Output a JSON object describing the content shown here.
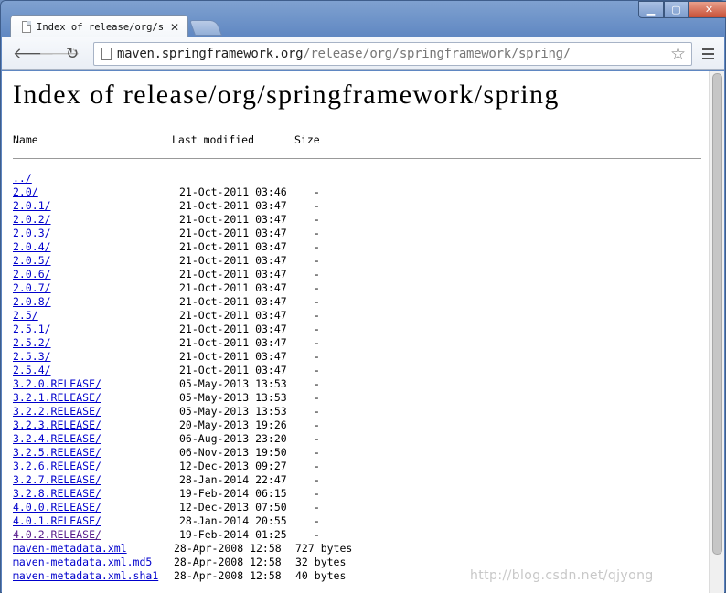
{
  "tab": {
    "title": "Index of release/org/sp"
  },
  "address_bar": {
    "host": "maven.springframework.org",
    "path": "/release/org/springframework/spring/"
  },
  "page": {
    "heading": "Index of release/org/springframework/spring",
    "columns": {
      "name": "Name",
      "modified": "Last modified",
      "size": "Size"
    },
    "dirs": [
      {
        "name": "../",
        "date": "",
        "size": ""
      },
      {
        "name": "2.0/",
        "date": "21-Oct-2011 03:46",
        "size": "-"
      },
      {
        "name": "2.0.1/",
        "date": "21-Oct-2011 03:47",
        "size": "-"
      },
      {
        "name": "2.0.2/",
        "date": "21-Oct-2011 03:47",
        "size": "-"
      },
      {
        "name": "2.0.3/",
        "date": "21-Oct-2011 03:47",
        "size": "-"
      },
      {
        "name": "2.0.4/",
        "date": "21-Oct-2011 03:47",
        "size": "-"
      },
      {
        "name": "2.0.5/",
        "date": "21-Oct-2011 03:47",
        "size": "-"
      },
      {
        "name": "2.0.6/",
        "date": "21-Oct-2011 03:47",
        "size": "-"
      },
      {
        "name": "2.0.7/",
        "date": "21-Oct-2011 03:47",
        "size": "-"
      },
      {
        "name": "2.0.8/",
        "date": "21-Oct-2011 03:47",
        "size": "-"
      },
      {
        "name": "2.5/",
        "date": "21-Oct-2011 03:47",
        "size": "-"
      },
      {
        "name": "2.5.1/",
        "date": "21-Oct-2011 03:47",
        "size": "-"
      },
      {
        "name": "2.5.2/",
        "date": "21-Oct-2011 03:47",
        "size": "-"
      },
      {
        "name": "2.5.3/",
        "date": "21-Oct-2011 03:47",
        "size": "-"
      },
      {
        "name": "2.5.4/",
        "date": "21-Oct-2011 03:47",
        "size": "-"
      },
      {
        "name": "3.2.0.RELEASE/",
        "date": "05-May-2013 13:53",
        "size": "-"
      },
      {
        "name": "3.2.1.RELEASE/",
        "date": "05-May-2013 13:53",
        "size": "-"
      },
      {
        "name": "3.2.2.RELEASE/",
        "date": "05-May-2013 13:53",
        "size": "-"
      },
      {
        "name": "3.2.3.RELEASE/",
        "date": "20-May-2013 19:26",
        "size": "-"
      },
      {
        "name": "3.2.4.RELEASE/",
        "date": "06-Aug-2013 23:20",
        "size": "-"
      },
      {
        "name": "3.2.5.RELEASE/",
        "date": "06-Nov-2013 19:50",
        "size": "-"
      },
      {
        "name": "3.2.6.RELEASE/",
        "date": "12-Dec-2013 09:27",
        "size": "-"
      },
      {
        "name": "3.2.7.RELEASE/",
        "date": "28-Jan-2014 22:47",
        "size": "-"
      },
      {
        "name": "3.2.8.RELEASE/",
        "date": "19-Feb-2014 06:15",
        "size": "-"
      },
      {
        "name": "4.0.0.RELEASE/",
        "date": "12-Dec-2013 07:50",
        "size": "-"
      },
      {
        "name": "4.0.1.RELEASE/",
        "date": "28-Jan-2014 20:55",
        "size": "-"
      },
      {
        "name": "4.0.2.RELEASE/",
        "date": "19-Feb-2014 01:25",
        "size": "-",
        "visited": true
      }
    ],
    "files": [
      {
        "name": "maven-metadata.xml",
        "date": "28-Apr-2008 12:58",
        "size": "727 bytes"
      },
      {
        "name": "maven-metadata.xml.md5",
        "date": "28-Apr-2008 12:58",
        "size": "32 bytes"
      },
      {
        "name": "maven-metadata.xml.sha1",
        "date": "28-Apr-2008 12:58",
        "size": "40 bytes"
      }
    ]
  },
  "watermark": "http://blog.csdn.net/qjyong"
}
